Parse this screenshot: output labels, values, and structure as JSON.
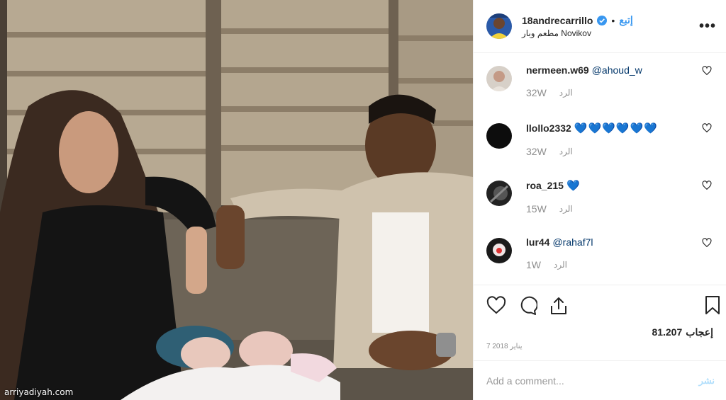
{
  "header": {
    "username": "18andrecarrillo",
    "separator": "•",
    "follow_label": "إتبع",
    "location": "مطعم وبار Novikov",
    "more_label": "•••"
  },
  "comments": [
    {
      "user": "nermeen.w69",
      "text": "@ahoud_w",
      "text_kind": "mention",
      "time": "32W",
      "reply": "الرد"
    },
    {
      "user": "llollo2332",
      "text": "💙💙💙💙💙💙",
      "text_kind": "hearts",
      "time": "32W",
      "reply": "الرد"
    },
    {
      "user": "roa_215",
      "text": "💙",
      "text_kind": "hearts",
      "time": "15W",
      "reply": "الرد"
    },
    {
      "user": "lur44",
      "text": "@rahaf7l",
      "text_kind": "mention",
      "time": "1W",
      "reply": "الرد"
    }
  ],
  "likes": {
    "count": "81.207",
    "label": "إعجاب"
  },
  "date": "7 يناير 2018",
  "add_comment": {
    "placeholder": "Add a comment...",
    "post_label": "نشر"
  },
  "watermark": "arriyadiyah.com",
  "colors": {
    "accent": "#3897f0",
    "muted": "#8e8e8e",
    "text": "#262626",
    "heart_blue": "#3fb8e7"
  }
}
